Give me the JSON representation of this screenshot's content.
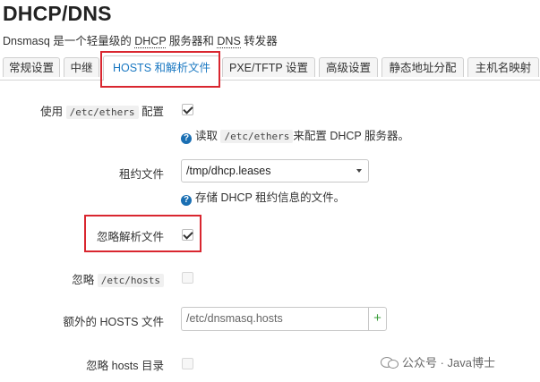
{
  "header": {
    "title": "DHCP/DNS",
    "desc_prefix": "Dnsmasq 是一个轻量级的 ",
    "desc_dhcp": "DHCP",
    "desc_middle": " 服务器和 ",
    "desc_dns": "DNS",
    "desc_suffix": " 转发器"
  },
  "tabs": [
    {
      "label": "常规设置",
      "active": false
    },
    {
      "label": "中继",
      "active": false
    },
    {
      "label": "HOSTS 和解析文件",
      "active": true
    },
    {
      "label": "PXE/TFTP 设置",
      "active": false
    },
    {
      "label": "高级设置",
      "active": false
    },
    {
      "label": "静态地址分配",
      "active": false
    },
    {
      "label": "主机名映射",
      "active": false
    }
  ],
  "form": {
    "use_ethers": {
      "label_prefix": "使用 ",
      "label_code": "/etc/ethers",
      "label_suffix": " 配置",
      "checked": true,
      "help_prefix": "读取 ",
      "help_code": "/etc/ethers",
      "help_suffix": "来配置 DHCP 服务器。"
    },
    "leasefile": {
      "label": "租约文件",
      "value": "/tmp/dhcp.leases",
      "help": "存储 DHCP 租约信息的文件。"
    },
    "noresolv": {
      "label": "忽略解析文件",
      "checked": true
    },
    "nohosts": {
      "label_prefix": "忽略 ",
      "label_code": "/etc/hosts",
      "checked": false
    },
    "addnhosts": {
      "label": "额外的 HOSTS 文件",
      "placeholder": "/etc/dnsmasq.hosts",
      "add_label": "+"
    },
    "ignore_hosts_dir": {
      "label": "忽略 hosts 目录",
      "checked": false
    }
  },
  "watermark": {
    "text": "公众号 · Java博士"
  },
  "colors": {
    "accent": "#1a78c2",
    "highlight": "#d9262f",
    "add_button": "#3a9e3a"
  },
  "icons": {
    "help": "help-circle-icon",
    "dropdown": "chevron-down-icon",
    "watermark": "wechat-logo-icon"
  }
}
